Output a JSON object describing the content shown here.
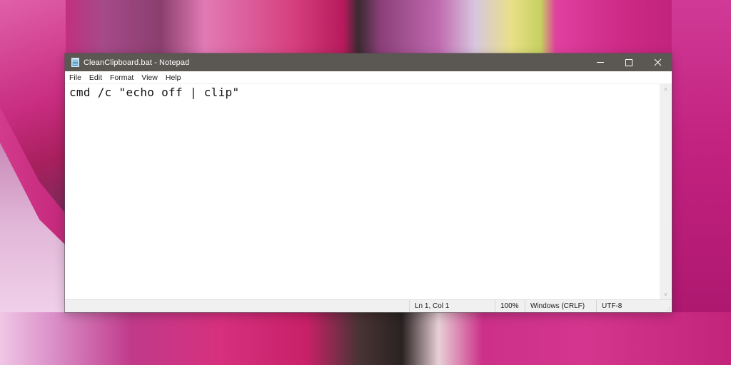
{
  "window": {
    "title": "CleanClipboard.bat - Notepad",
    "app_icon": "notepad-icon",
    "controls": {
      "minimize_icon": "minimize-icon",
      "maximize_icon": "maximize-icon",
      "close_icon": "close-icon"
    }
  },
  "menu": {
    "items": [
      {
        "label": "File"
      },
      {
        "label": "Edit"
      },
      {
        "label": "Format"
      },
      {
        "label": "View"
      },
      {
        "label": "Help"
      }
    ]
  },
  "editor": {
    "content": "cmd /c \"echo off | clip\""
  },
  "scrollbar": {
    "up_arrow": "˄",
    "down_arrow": "˅"
  },
  "statusbar": {
    "position": "Ln 1, Col 1",
    "zoom": "100%",
    "line_ending": "Windows (CRLF)",
    "encoding": "UTF-8"
  },
  "colors": {
    "titlebar": "#5b5752",
    "wallpaper_accent": "#c82a80"
  }
}
